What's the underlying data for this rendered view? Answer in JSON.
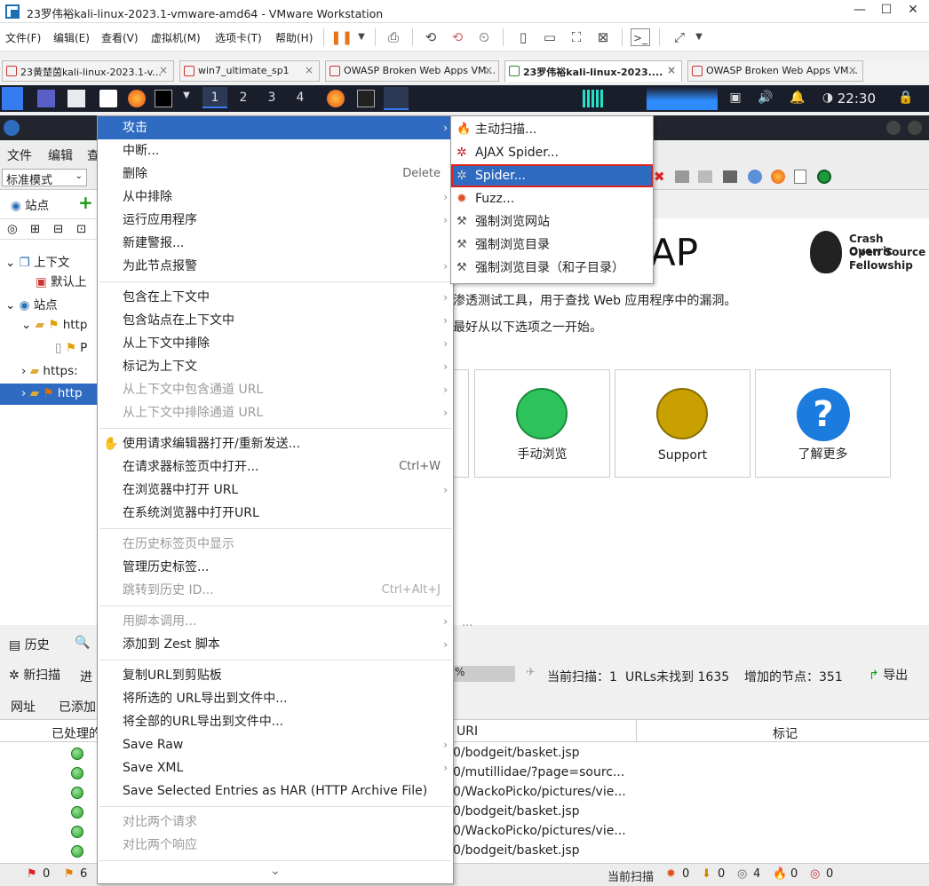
{
  "vm": {
    "title": "23罗伟裕kali-linux-2023.1-vmware-amd64 - VMware Workstation",
    "menu": [
      "文件(F)",
      "编辑(E)",
      "查看(V)",
      "虚拟机(M)",
      "选项卡(T)",
      "帮助(H)"
    ],
    "tabs": [
      {
        "label": "23黄楚茵kali-linux-2023.1-v..."
      },
      {
        "label": "win7_ultimate_sp1"
      },
      {
        "label": "OWASP Broken Web Apps VM..."
      },
      {
        "label": "23罗伟裕kali-linux-2023...."
      },
      {
        "label": "OWASP Broken Web Apps VM..."
      }
    ],
    "close_glyph": "×"
  },
  "kali": {
    "workspaces": [
      "1",
      "2",
      "3",
      "4"
    ],
    "clock": "22:30"
  },
  "zap": {
    "menu": [
      "文件",
      "编辑",
      "查"
    ],
    "mode": "标准模式",
    "tree_tab": "站点",
    "tree": {
      "context_root": "上下文",
      "default_context": "默认上",
      "sites_root": "站点",
      "site1": "http",
      "site1_child": "P",
      "site2": "https:",
      "site3": "http"
    },
    "welcome": {
      "logo_text": "AP",
      "desc1": "渗透测试工具，用于查找 Web 应用程序中的漏洞。",
      "desc2": "最好从以下选项之一开始。",
      "crash1": "Crash Overric",
      "crash2": "Open Source",
      "crash3": "Fellowship",
      "buttons": [
        "手动浏览",
        "Support",
        "了解更多"
      ]
    },
    "bottom": {
      "tab_history": "历史",
      "new_scan": "新扫描",
      "progress_prefix": "进",
      "progress_pct": "%",
      "current_scan": "当前扫描：1",
      "urls_found": "URLs未找到 1635",
      "added_nodes": "增加的节点：351",
      "export": "导出",
      "sub_tabs": [
        "网址",
        "已添加"
      ],
      "col_processed": "已处理的",
      "col_uri": "URI",
      "col_flag": "标记",
      "rows": [
        "0/bodgeit/basket.jsp",
        "0/mutillidae/?page=sourc...",
        "0/WackoPicko/pictures/vie...",
        "0/bodgeit/basket.jsp",
        "0/WackoPicko/pictures/vie...",
        "0/bodgeit/basket.jsp"
      ],
      "status_left": [
        "0",
        "6"
      ],
      "status_right": {
        "label": "当前扫描",
        "counts": [
          "0",
          "0",
          "4",
          "0",
          "0"
        ]
      },
      "dots_grip": "···"
    }
  },
  "context_menu": {
    "items": [
      {
        "label": "攻击",
        "arrow": true,
        "hi": true
      },
      {
        "label": "中断..."
      },
      {
        "label": "删除",
        "shortcut": "Delete"
      },
      {
        "label": "从中排除",
        "arrow": true
      },
      {
        "label": "运行应用程序",
        "arrow": true
      },
      {
        "label": "新建警报..."
      },
      {
        "label": "为此节点报警",
        "arrow": true
      },
      {
        "label": "包含在上下文中",
        "arrow": true
      },
      {
        "label": "包含站点在上下文中",
        "arrow": true
      },
      {
        "label": "从上下文中排除",
        "arrow": true
      },
      {
        "label": "标记为上下文",
        "arrow": true
      },
      {
        "label": "从上下文中包含通道 URL",
        "arrow": true,
        "disabled": true
      },
      {
        "label": "从上下文中排除通道 URL",
        "arrow": true,
        "disabled": true
      },
      {
        "label": "使用请求编辑器打开/重新发送..."
      },
      {
        "label": "在请求器标签页中打开...",
        "shortcut": "Ctrl+W"
      },
      {
        "label": "在浏览器中打开 URL",
        "arrow": true
      },
      {
        "label": "在系统浏览器中打开URL"
      },
      {
        "label": "在历史标签页中显示",
        "disabled": true
      },
      {
        "label": "管理历史标签..."
      },
      {
        "label": "跳转到历史 ID...",
        "shortcut": "Ctrl+Alt+J",
        "disabled": true
      },
      {
        "label": "用脚本调用...",
        "arrow": true,
        "disabled": true
      },
      {
        "label": "添加到 Zest 脚本",
        "arrow": true
      },
      {
        "label": "复制URL到剪贴板"
      },
      {
        "label": "将所选的 URL导出到文件中..."
      },
      {
        "label": "将全部的URL导出到文件中..."
      },
      {
        "label": "Save Raw",
        "arrow": true
      },
      {
        "label": "Save XML",
        "arrow": true
      },
      {
        "label": "Save Selected Entries as HAR (HTTP Archive File)"
      },
      {
        "label": "对比两个请求",
        "disabled": true
      },
      {
        "label": "对比两个响应",
        "disabled": true
      }
    ],
    "arrow_glyph": "›",
    "more_glyph": "⌄"
  },
  "submenu": {
    "items": [
      {
        "label": "主动扫描..."
      },
      {
        "label": "AJAX Spider..."
      },
      {
        "label": "Spider...",
        "hi": true
      },
      {
        "label": "Fuzz..."
      },
      {
        "label": "强制浏览网站"
      },
      {
        "label": "强制浏览目录"
      },
      {
        "label": "强制浏览目录（和子目录）"
      }
    ]
  },
  "colors": {
    "highlight": "#2f6bc1",
    "outline": "#dd2222",
    "kali_panel": "#1a1e2a"
  }
}
